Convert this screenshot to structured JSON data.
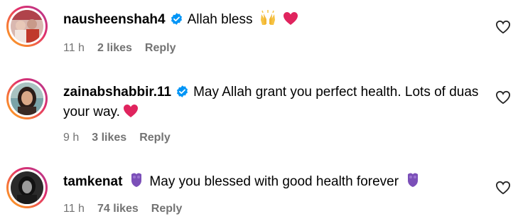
{
  "comments": [
    {
      "username": "nausheenshah4",
      "verified": true,
      "text": "Allah bless",
      "time": "11 h",
      "likes": "2 likes",
      "reply": "Reply"
    },
    {
      "username": "zainabshabbir.11",
      "verified": true,
      "text": "May Allah grant you perfect health. Lots of duas your way.",
      "time": "9 h",
      "likes": "3 likes",
      "reply": "Reply"
    },
    {
      "username": "tamkenat",
      "verified": false,
      "text": "May you blessed with good health forever",
      "time": "11 h",
      "likes": "74 likes",
      "reply": "Reply"
    }
  ],
  "icons": {
    "verified": "verified-badge-icon",
    "like": "heart-outline-icon",
    "emoji_praise": "raised-hands-emoji",
    "emoji_heart": "red-heart-emoji",
    "emoji_shield": "purple-shield-emoji"
  },
  "colors": {
    "text": "#000000",
    "meta": "#737373",
    "verified": "#0095f6",
    "heart_emoji": "#e0245e",
    "shield_emoji": "#7b4fb8"
  }
}
